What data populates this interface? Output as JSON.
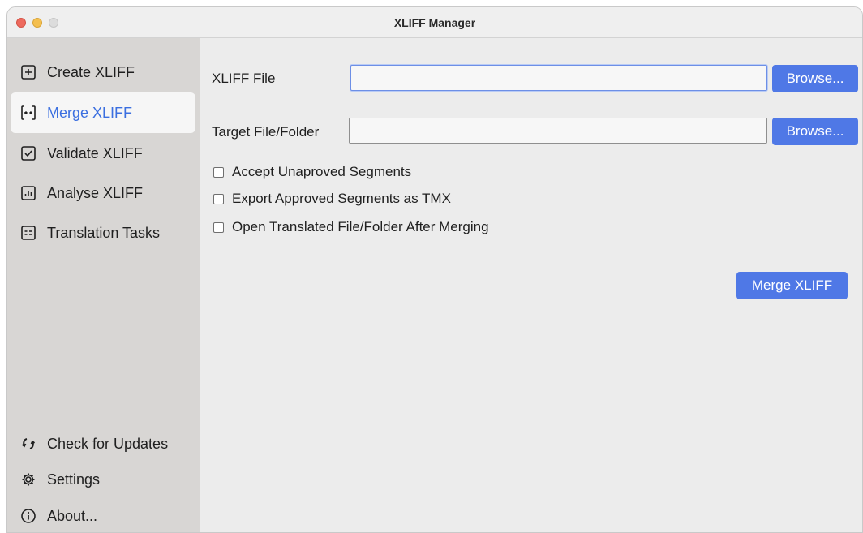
{
  "window": {
    "title": "XLIFF Manager"
  },
  "sidebar": {
    "items": [
      {
        "label": "Create XLIFF",
        "icon": "plus-square-icon",
        "active": false
      },
      {
        "label": "Merge XLIFF",
        "icon": "merge-icon",
        "active": true
      },
      {
        "label": "Validate XLIFF",
        "icon": "check-square-icon",
        "active": false
      },
      {
        "label": "Analyse XLIFF",
        "icon": "bar-chart-icon",
        "active": false
      },
      {
        "label": "Translation Tasks",
        "icon": "tasks-icon",
        "active": false
      }
    ],
    "bottom_items": [
      {
        "label": "Check for Updates",
        "icon": "refresh-icon"
      },
      {
        "label": "Settings",
        "icon": "gear-icon"
      },
      {
        "label": "About...",
        "icon": "info-icon"
      }
    ]
  },
  "form": {
    "xliff_file_label": "XLIFF File",
    "xliff_file_value": "",
    "target_label": "Target File/Folder",
    "target_value": "",
    "browse_label": "Browse...",
    "options": [
      {
        "label": "Accept Unaproved Segments",
        "checked": false
      },
      {
        "label": "Export Approved Segments as TMX",
        "checked": false
      },
      {
        "label": "Open Translated File/Folder After Merging",
        "checked": false
      }
    ],
    "submit_label": "Merge XLIFF"
  },
  "colors": {
    "accent": "#4f78e6",
    "active_text": "#3b6fe0",
    "sidebar_bg": "#d8d6d4",
    "content_bg": "#ececec"
  }
}
